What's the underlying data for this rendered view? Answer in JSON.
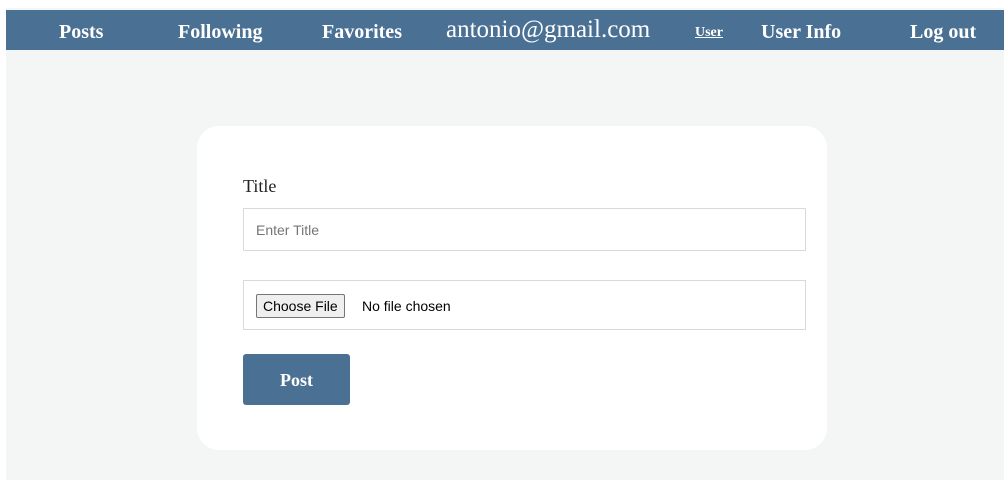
{
  "nav": {
    "posts": "Posts",
    "following": "Following",
    "favorites": "Favorites",
    "email": "antonio@gmail.com",
    "user": "User",
    "user_info": "User Info",
    "log_out": "Log out"
  },
  "form": {
    "title_label": "Title",
    "title_placeholder": "Enter Title",
    "title_value": "",
    "file_button_label": "Choose File",
    "file_status": "No file chosen",
    "post_label": "Post"
  },
  "colors": {
    "navbar": "#4a7194",
    "page_background": "#f4f5f5",
    "card": "#ffffff",
    "post_button": "#4a7194"
  }
}
